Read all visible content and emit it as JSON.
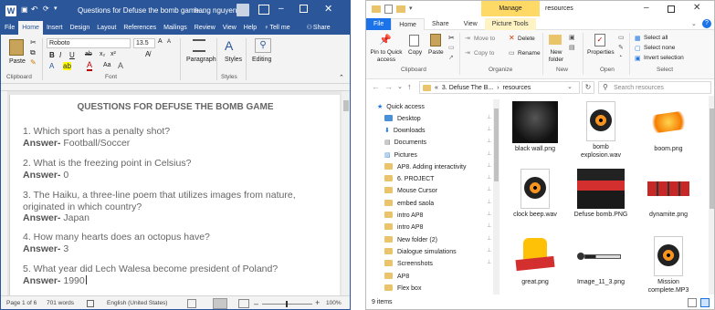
{
  "word": {
    "quick_access": [
      "↶",
      "⟳",
      "▾"
    ],
    "title": "Questions for Defuse the bomb game...",
    "user": "hang nguyen",
    "tabs": [
      "File",
      "Home",
      "Insert",
      "Design",
      "Layout",
      "References",
      "Mailings",
      "Review",
      "View",
      "Help"
    ],
    "tell_me": "Tell me",
    "share": "Share",
    "font_name": "Roboto",
    "font_size": "13.5",
    "groups": {
      "clipboard": "Clipboard",
      "font": "Font",
      "paragraph": "Paragraph",
      "styles": "Styles",
      "editing": "Editing"
    },
    "paste_label": "Paste",
    "doc_title": "QUESTIONS FOR DEFUSE THE BOMB GAME",
    "qa": [
      {
        "q": "1. Which sport has a penalty shot?",
        "label": "Answer-",
        "a": " Football/Soccer"
      },
      {
        "q": "2. What is the freezing point in Celsius?",
        "label": "Answer-",
        "a": " 0"
      },
      {
        "q": "3. The Haiku, a three-line poem that utilizes images from nature, originated in which country?",
        "label": "Answer-",
        "a": " Japan"
      },
      {
        "q": "4. How many hearts does an octopus have?",
        "label": "Answer-",
        "a": " 3"
      },
      {
        "q": "5. What year did Lech Walesa become president of Poland?",
        "label": "Answer-",
        "a": " 1990"
      }
    ],
    "status": {
      "page": "Page 1 of 6",
      "words": "701 words",
      "language": "English (United States)",
      "zoom": "100%"
    },
    "colors": {
      "brand": "#2b579a"
    }
  },
  "explorer": {
    "title": "resources",
    "manage": "Manage",
    "tabs": [
      "File",
      "Home",
      "Share",
      "View",
      "Picture Tools"
    ],
    "ribbon": {
      "pin": "Pin to Quick access",
      "copy": "Copy",
      "paste": "Paste",
      "move_to": "Move to",
      "delete": "Delete",
      "copy_to": "Copy to",
      "rename": "Rename",
      "new_folder": "New folder",
      "properties": "Properties",
      "select_all": "Select all",
      "select_none": "Select none",
      "invert": "Invert selection",
      "groups": {
        "clipboard": "Clipboard",
        "organize": "Organize",
        "new": "New",
        "open": "Open",
        "select": "Select"
      }
    },
    "path": [
      "«",
      "3. Defuse The B...",
      "›",
      "resources"
    ],
    "search_placeholder": "Search resources",
    "nav": [
      "Quick access",
      "Desktop",
      "Downloads",
      "Documents",
      "Pictures",
      "AP8. Adding interactivity",
      "6. PROJECT",
      "Mouse Cursor",
      "embed saola",
      "intro AP8",
      "intro AP8",
      "New folder (2)",
      "Dialogue simulations",
      "Screenshots",
      "AP8",
      "Flex box"
    ],
    "files": [
      "black wall.png",
      "bomb explosion.wav",
      "boom.png",
      "clock beep.wav",
      "Defuse bomb.PNG",
      "dynamite.png",
      "great.png",
      "Image_11_3.png",
      "Mission complete.MP3"
    ],
    "item_count": "9 items",
    "colors": {
      "manage": "#ffd966",
      "accent": "#1a73e8"
    }
  }
}
